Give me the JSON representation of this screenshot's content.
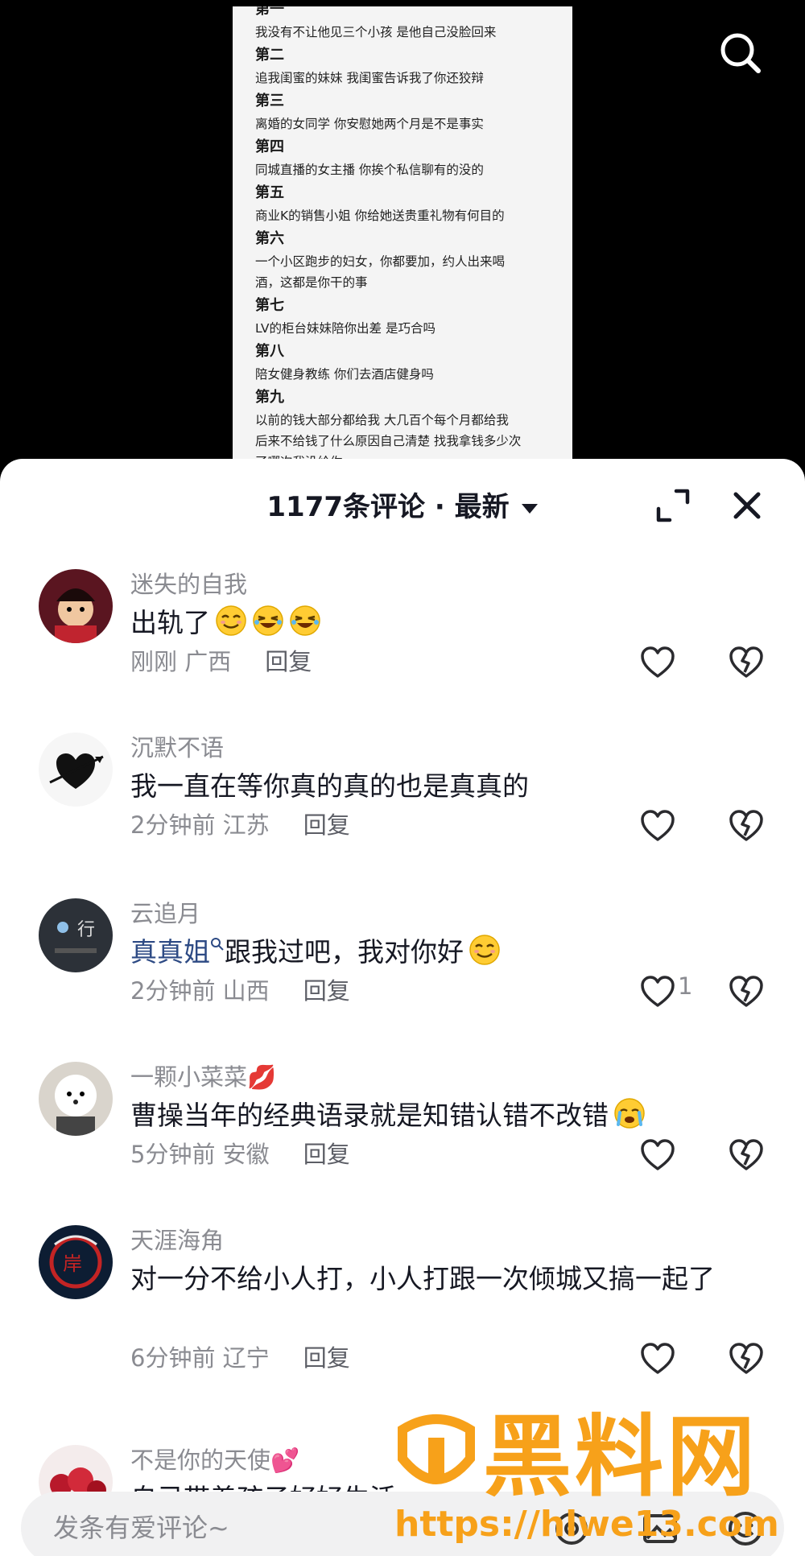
{
  "note": {
    "lines": [
      {
        "kind": "head",
        "text": "第一"
      },
      {
        "kind": "line",
        "text": "我没有不让他见三个小孩 是他自己没脸回来"
      },
      {
        "kind": "head",
        "text": "第二"
      },
      {
        "kind": "line",
        "text": "追我闺蜜的妹妹 我闺蜜告诉我了你还狡辩"
      },
      {
        "kind": "head",
        "text": "第三"
      },
      {
        "kind": "line",
        "text": "离婚的女同学 你安慰她两个月是不是事实"
      },
      {
        "kind": "head",
        "text": "第四"
      },
      {
        "kind": "line",
        "text": "同城直播的女主播 你挨个私信聊有的没的"
      },
      {
        "kind": "head",
        "text": "第五"
      },
      {
        "kind": "line",
        "text": "商业K的销售小姐 你给她送贵重礼物有何目的"
      },
      {
        "kind": "head",
        "text": "第六"
      },
      {
        "kind": "line",
        "text": "一个小区跑步的妇女，你都要加，约人出来喝"
      },
      {
        "kind": "line",
        "text": "酒，这都是你干的事"
      },
      {
        "kind": "head",
        "text": "第七"
      },
      {
        "kind": "line",
        "text": "LV的柜台妹妹陪你出差 是巧合吗"
      },
      {
        "kind": "head",
        "text": "第八"
      },
      {
        "kind": "line",
        "text": "陪女健身教练 你们去酒店健身吗"
      },
      {
        "kind": "head",
        "text": "第九"
      },
      {
        "kind": "line",
        "text": "以前的钱大部分都给我 大几百个每个月都给我"
      },
      {
        "kind": "line",
        "text": "后来不给钱了什么原因自己清楚 找我拿钱多少次"
      },
      {
        "kind": "line",
        "text": "了哪次我没给你"
      }
    ]
  },
  "header": {
    "title": "1177条评论 · 最新",
    "icons": {
      "search": "search-icon",
      "expand": "expand-icon",
      "close": "close-icon",
      "sort": "caret-down-icon"
    }
  },
  "comments": [
    {
      "name": "迷失的自我",
      "text": "出轨了",
      "emojis": [
        "smirk",
        "laugh",
        "laugh"
      ],
      "time": "刚刚",
      "location": "广西",
      "reply": "回复",
      "likes": "",
      "avatar": "avatar-red-character"
    },
    {
      "name": "沉默不语",
      "text": "我一直在等你真的真的也是真真的",
      "emojis": [],
      "time": "2分钟前",
      "location": "江苏",
      "reply": "回复",
      "likes": "",
      "avatar": "avatar-heart-arrow"
    },
    {
      "name": "云追月",
      "mention": "真真姐",
      "text": "跟我过吧，我对你好",
      "emojis": [
        "smirk"
      ],
      "time": "2分钟前",
      "location": "山西",
      "reply": "回复",
      "likes": "1",
      "avatar": "avatar-dark-moon"
    },
    {
      "name": "一颗小菜菜💋",
      "text": "曹操当年的经典语录就是知错认错不改错",
      "emojis": [
        "cry"
      ],
      "time": "5分钟前",
      "location": "安徽",
      "reply": "回复",
      "likes": "",
      "avatar": "avatar-white-dog"
    },
    {
      "name": "天涯海角",
      "text": "对一分不给小人打，小人打跟一次倾城又搞一起了",
      "emojis": [],
      "time": "6分钟前",
      "location": "辽宁",
      "reply": "回复",
      "likes": "",
      "avatar": "avatar-red-emblem"
    },
    {
      "name": "不是你的天使💕",
      "text": "自己带着孩子好好生活",
      "emojis": [],
      "time": "",
      "location": "",
      "reply": "",
      "likes": "",
      "avatar": "avatar-red-flowers"
    }
  ],
  "input": {
    "placeholder": "发条有爱评论~",
    "icons": [
      "at-icon",
      "image-icon",
      "emoji-icon"
    ]
  },
  "watermark": {
    "title": "黑料网",
    "url": "https://hlwe13.com"
  },
  "colors": {
    "accent": "#f7a11a",
    "muted": "#8a8b91",
    "text": "#161823",
    "mention": "#2d4a84"
  }
}
